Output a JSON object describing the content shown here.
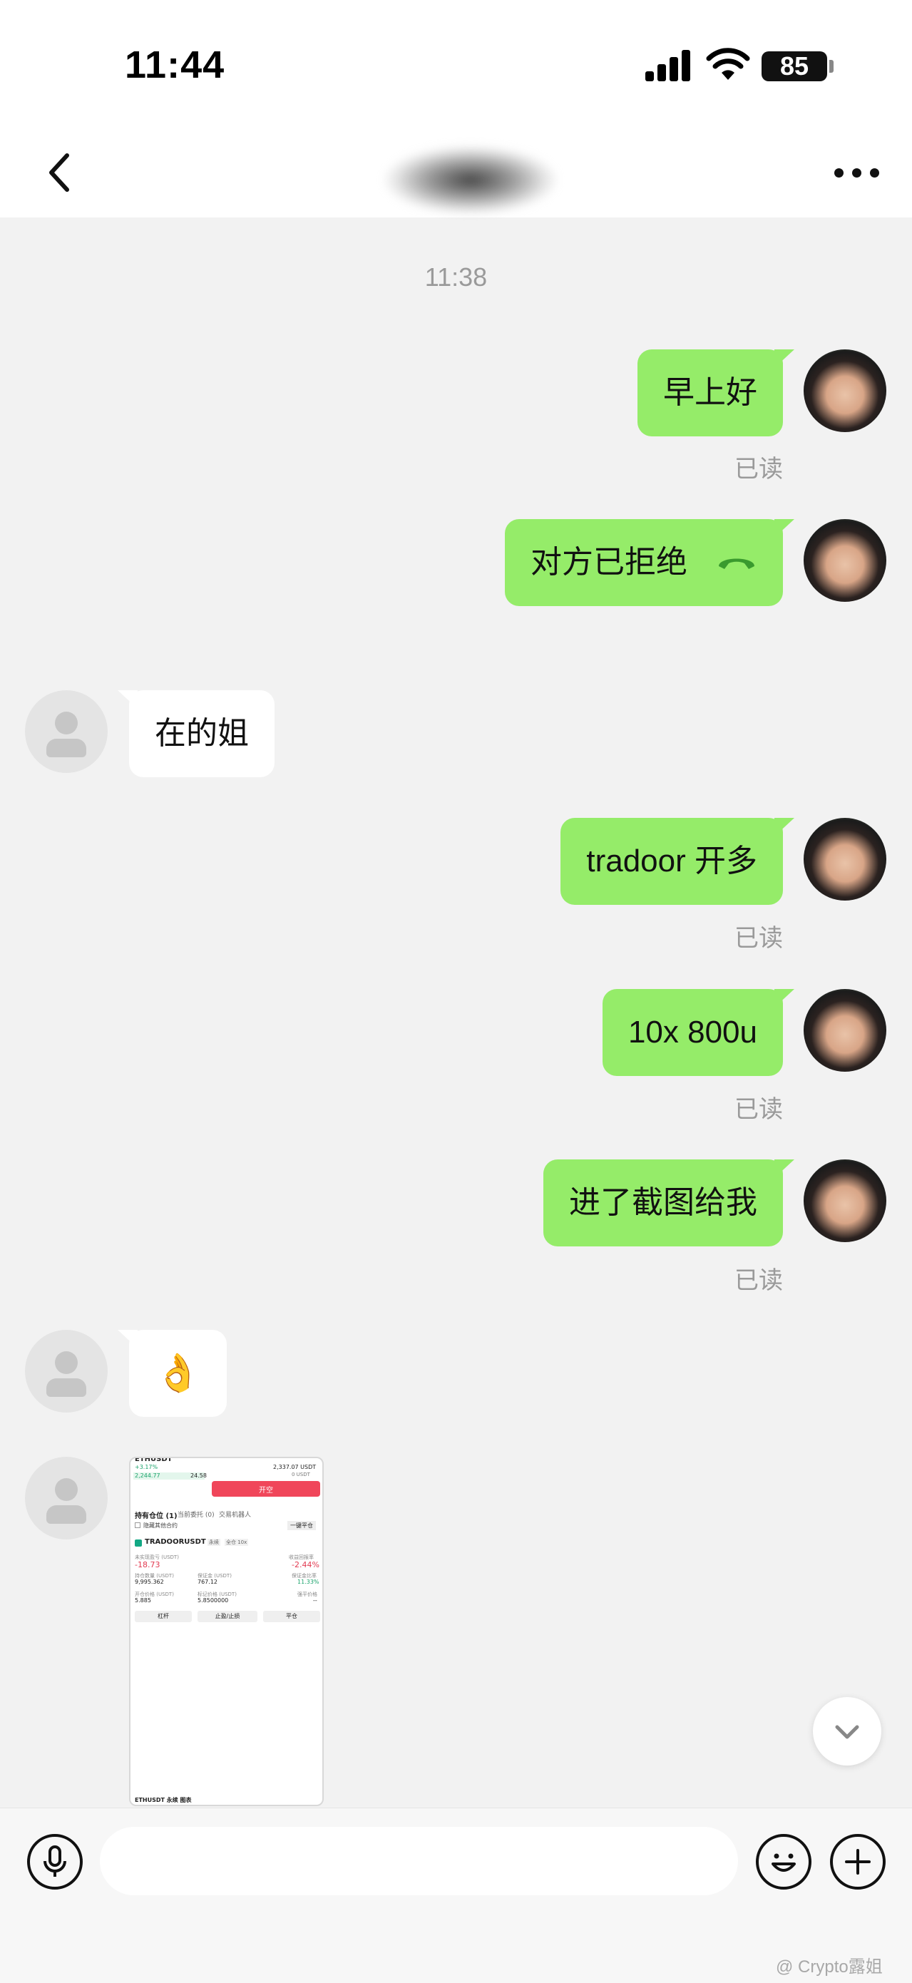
{
  "status_bar": {
    "time": "11:44",
    "battery": "85"
  },
  "chat": {
    "timestamp": "11:38",
    "messages": [
      {
        "side": "me",
        "text": "早上好",
        "read": "已读"
      },
      {
        "side": "me",
        "text": "对方已拒绝",
        "icon": "phone-hangup-icon"
      },
      {
        "side": "other",
        "text": "在的姐"
      },
      {
        "side": "me",
        "text": "tradoor 开多",
        "read": "已读"
      },
      {
        "side": "me",
        "text": "10x 800u",
        "read": "已读"
      },
      {
        "side": "me",
        "text": "进了截图给我",
        "read": "已读"
      },
      {
        "side": "other",
        "text": "👌"
      },
      {
        "side": "other",
        "type": "image"
      }
    ]
  },
  "shared_screenshot": {
    "top_rows": [
      "ETHUSDT",
      "+3.17%",
      "2,244.77",
      "24.58",
      "2,337.07 USDT",
      "0 USDT",
      "开空"
    ],
    "tabs": [
      "持有仓位 (1)",
      "当前委托 (0)",
      "交易机器人"
    ],
    "filter": "隐藏其他合约",
    "close_all": "一键平仓",
    "symbol": "TRADOORUSDT",
    "tags": [
      "永续",
      "全仓 10x"
    ],
    "unrealized_pnl_label": "未实现盈亏 (USDT)",
    "unrealized_pnl": "-18.73",
    "roe_label": "收益回报率",
    "roe": "-2.44%",
    "size_label": "持仓数量 (USDT)",
    "size": "9,995.362",
    "margin_label": "保证金 (USDT)",
    "margin": "767.12",
    "margin_ratio_label": "保证金比率",
    "margin_ratio": "11.33%",
    "entry_label": "开仓价格 (USDT)",
    "entry": "5.885",
    "mark_label": "标记价格 (USDT)",
    "mark": "5.8500000",
    "liq_label": "强平价格",
    "liq": "--",
    "buttons": [
      "杠杆",
      "止盈/止损",
      "平仓"
    ],
    "footer": "ETHUSDT 永续 图表"
  },
  "input_bar": {
    "placeholder": ""
  },
  "watermark": "@ Crypto露姐"
}
